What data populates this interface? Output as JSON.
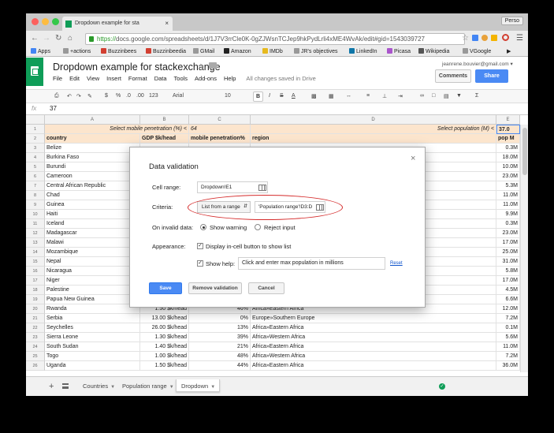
{
  "browser": {
    "tab_title": "Dropdown example for sta",
    "tab_close": "×",
    "profile": "Perso",
    "url_secure": "https://",
    "url_rest": "docs.google.com/spreadsheets/d/1J7V3rrCle0K-0gZJWsnTCJep9hkPydLrli4xME4WvAk/edit#gid=1543039727",
    "bookmarks": [
      {
        "label": "Apps",
        "color": "#4285f4"
      },
      {
        "label": "+actions",
        "color": "#999999"
      },
      {
        "label": "Buzzinbees",
        "color": "#d23f31"
      },
      {
        "label": "Buzzinbeedia",
        "color": "#d23f31"
      },
      {
        "label": "GMail",
        "color": "#999999"
      },
      {
        "label": "Amazon",
        "color": "#222222"
      },
      {
        "label": "IMDb",
        "color": "#e6b91e"
      },
      {
        "label": "JR's objectives",
        "color": "#999999"
      },
      {
        "label": "LinkedIn",
        "color": "#0e76a8"
      },
      {
        "label": "Picasa",
        "color": "#aa55cc"
      },
      {
        "label": "Wikipedia",
        "color": "#555555"
      },
      {
        "label": "VGoogle",
        "color": "#999999"
      }
    ]
  },
  "doc": {
    "title": "Dropdown example for stackexchange",
    "email": "jeanrene.bouvier@gmail.com ▾",
    "comments": "Comments",
    "share": "Share",
    "menu": [
      "File",
      "Edit",
      "View",
      "Insert",
      "Format",
      "Data",
      "Tools",
      "Add-ons",
      "Help"
    ],
    "saved": "All changes saved in Drive"
  },
  "toolbar": {
    "zoom": "123",
    "font": "Arial",
    "size": "10",
    "bold": "B",
    "italic": "I",
    "strike": "S",
    "color_a": "A"
  },
  "formula": {
    "fx": "fx",
    "value": "37"
  },
  "grid": {
    "columns": [
      "A",
      "B",
      "C",
      "D",
      "E"
    ],
    "row1": {
      "a": "Select mobile penetration (%) <",
      "b": "64",
      "d": "Select population (M) <",
      "e": "37.0"
    },
    "header": [
      "country",
      "GDP $k/head",
      "mobile penetration%",
      "region",
      "pop M"
    ],
    "rows": [
      {
        "n": "3",
        "a": "Belize",
        "b": "",
        "c": "",
        "d": "",
        "e": "0.3M"
      },
      {
        "n": "4",
        "a": "Burkina Faso",
        "b": "",
        "c": "",
        "d": "",
        "e": "18.0M"
      },
      {
        "n": "5",
        "a": "Burundi",
        "b": "",
        "c": "",
        "d": "",
        "e": "10.0M"
      },
      {
        "n": "6",
        "a": "Cameroon",
        "b": "",
        "c": "",
        "d": "",
        "e": "23.0M"
      },
      {
        "n": "7",
        "a": "Central African Republic",
        "b": "",
        "c": "",
        "d": "",
        "e": "5.3M"
      },
      {
        "n": "8",
        "a": "Chad",
        "b": "",
        "c": "",
        "d": "",
        "e": "11.0M"
      },
      {
        "n": "9",
        "a": "Guinea",
        "b": "",
        "c": "",
        "d": "",
        "e": "11.0M"
      },
      {
        "n": "10",
        "a": "Haiti",
        "b": "",
        "c": "",
        "d": "",
        "e": "9.9M"
      },
      {
        "n": "11",
        "a": "Iceland",
        "b": "",
        "c": "",
        "d": "",
        "e": "0.3M"
      },
      {
        "n": "12",
        "a": "Madagascar",
        "b": "",
        "c": "",
        "d": "",
        "e": "23.0M"
      },
      {
        "n": "13",
        "a": "Malawi",
        "b": "",
        "c": "",
        "d": "",
        "e": "17.0M"
      },
      {
        "n": "14",
        "a": "Mozambique",
        "b": "",
        "c": "",
        "d": "",
        "e": "25.0M"
      },
      {
        "n": "15",
        "a": "Nepal",
        "b": "",
        "c": "",
        "d": "",
        "e": "31.0M"
      },
      {
        "n": "16",
        "a": "Nicaragua",
        "b": "",
        "c": "",
        "d": "",
        "e": "5.8M"
      },
      {
        "n": "17",
        "a": "Niger",
        "b": "",
        "c": "",
        "d": "",
        "e": "17.0M"
      },
      {
        "n": "18",
        "a": "Palestine",
        "b": "",
        "c": "",
        "d": "",
        "e": "4.5M"
      },
      {
        "n": "19",
        "a": "Papua New Guinea",
        "b": "",
        "c": "",
        "d": "",
        "e": "6.6M"
      },
      {
        "n": "20",
        "a": "Rwanda",
        "b": "1.50 $k/head",
        "c": "46%",
        "d": "Africa»Eastern Africa",
        "e": "12.0M"
      },
      {
        "n": "21",
        "a": "Serbia",
        "b": "13.00 $k/head",
        "c": "0%",
        "d": "Europe»Southern Europe",
        "e": "7.2M"
      },
      {
        "n": "22",
        "a": "Seychelles",
        "b": "26.00 $k/head",
        "c": "13%",
        "d": "Africa»Eastern Africa",
        "e": "0.1M"
      },
      {
        "n": "23",
        "a": "Sierra Leone",
        "b": "1.30 $k/head",
        "c": "39%",
        "d": "Africa»Western Africa",
        "e": "5.6M"
      },
      {
        "n": "24",
        "a": "South Sudan",
        "b": "1.40 $k/head",
        "c": "21%",
        "d": "Africa»Eastern Africa",
        "e": "11.0M"
      },
      {
        "n": "25",
        "a": "Togo",
        "b": "1.00 $k/head",
        "c": "48%",
        "d": "Africa»Western Africa",
        "e": "7.2M"
      },
      {
        "n": "26",
        "a": "Uganda",
        "b": "1.50 $k/head",
        "c": "44%",
        "d": "Africa»Eastern Africa",
        "e": "36.0M"
      }
    ]
  },
  "sheets": {
    "tabs": [
      "Countries",
      "Population range",
      "Dropdown"
    ],
    "active": "Dropdown",
    "add": "+"
  },
  "dialog": {
    "title": "Data validation",
    "close": "×",
    "cell_range_label": "Cell range:",
    "cell_range_value": "Dropdown!E1",
    "criteria_label": "Criteria:",
    "criteria_select": "List from a range",
    "criteria_range": "'Population range'!D3:D",
    "invalid_label": "On invalid data:",
    "show_warning": "Show warning",
    "reject_input": "Reject input",
    "appearance_label": "Appearance:",
    "show_dropdown": "Display in-cell button to show list",
    "show_help": "Show help:",
    "help_text": "Click and enter max population in millions",
    "reset": "Reset",
    "save": "Save",
    "remove": "Remove validation",
    "cancel": "Cancel"
  }
}
